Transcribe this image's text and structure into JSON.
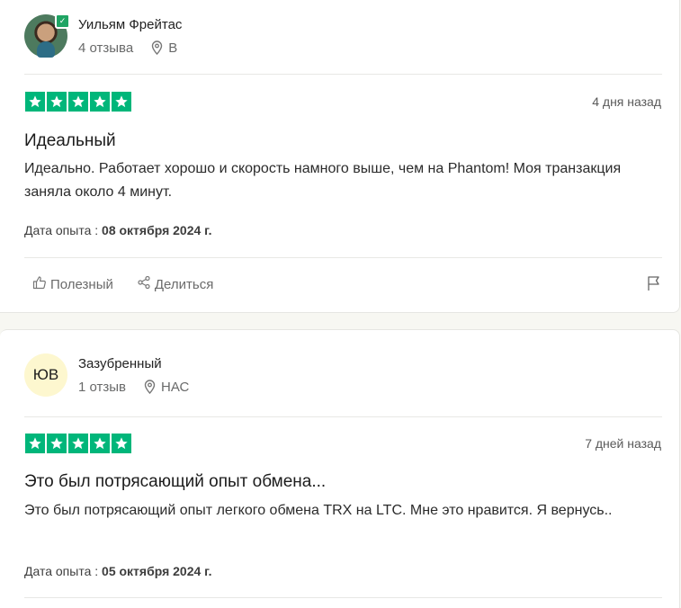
{
  "reviews": [
    {
      "author": "Уильям Фрейтас",
      "review_count": "4 отзыва",
      "location": "В",
      "avatar": {
        "type": "photo",
        "verified": true
      },
      "rating": 5,
      "date_ago": "4 дня назад",
      "title": "Идеальный",
      "body": "Идеально. Работает хорошо и скорость намного выше, чем на Phantom! Моя транзакция заняла около 4 минут.",
      "experience_label": "Дата опыта :",
      "experience_date": "08 октября 2024 г.",
      "actions": {
        "useful": "Полезный",
        "share": "Делиться"
      }
    },
    {
      "author": "Зазубренный",
      "review_count": "1 отзыв",
      "location": "НАС",
      "avatar": {
        "type": "initials",
        "initials": "ЮВ"
      },
      "rating": 5,
      "date_ago": "7 дней назад",
      "title": "Это был потрясающий опыт обмена...",
      "body": "Это был потрясающий опыт легкого обмена TRX на LTC. Мне это нравится. Я вернусь..",
      "experience_label": "Дата опыта :",
      "experience_date": "05 октября 2024 г."
    }
  ],
  "colors": {
    "star_bg": "#00b67a",
    "verified": "#1fa463",
    "initials_bg": "#fdf7cf"
  }
}
